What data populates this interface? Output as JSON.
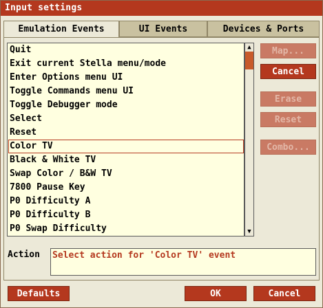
{
  "window": {
    "title": "Input settings"
  },
  "tabs": [
    {
      "label": "Emulation Events",
      "active": true
    },
    {
      "label": "UI Events",
      "active": false
    },
    {
      "label": "Devices & Ports",
      "active": false
    }
  ],
  "events": [
    "Quit",
    "Exit current Stella menu/mode",
    "Enter Options menu UI",
    "Toggle Commands menu UI",
    "Toggle Debugger mode",
    "Select",
    "Reset",
    "Color TV",
    "Black & White TV",
    "Swap Color / B&W TV",
    "7800 Pause Key",
    "P0 Difficulty A",
    "P0 Difficulty B",
    "P0 Swap Difficulty"
  ],
  "selected_event": "Color TV",
  "side_buttons": {
    "map": "Map...",
    "cancel": "Cancel",
    "erase": "Erase",
    "reset": "Reset",
    "combo": "Combo..."
  },
  "action": {
    "label": "Action",
    "text": "Select action for 'Color TV' event"
  },
  "footer": {
    "defaults": "Defaults",
    "ok": "OK",
    "cancel": "Cancel"
  },
  "colors": {
    "accent": "#b4381e",
    "list_background": "#ffffe0",
    "window_background": "#ece9d8"
  }
}
